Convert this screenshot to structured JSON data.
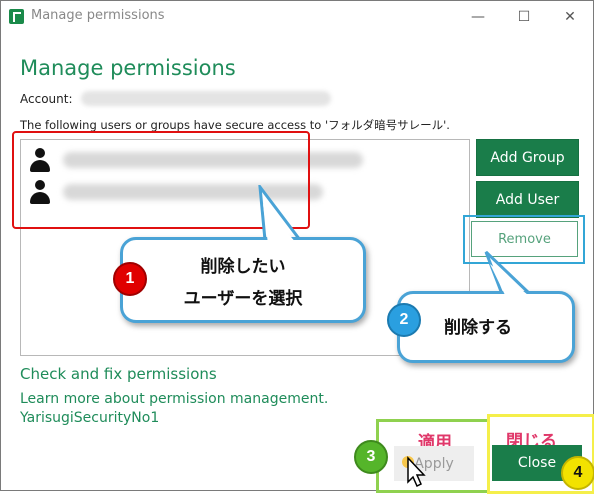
{
  "window": {
    "title": "Manage permissions",
    "controls": {
      "minimize": "—",
      "maximize": "☐",
      "close": "✕"
    }
  },
  "dialog": {
    "heading": "Manage permissions",
    "account_label": "Account:",
    "description": "The following users or groups have secure access to 'フォルダ暗号サレール'.",
    "users": [
      {
        "icon": "person-icon"
      },
      {
        "icon": "person-icon"
      }
    ],
    "buttons": {
      "add_group": "Add Group",
      "add_user": "Add User",
      "remove": "Remove",
      "apply": "Apply",
      "close": "Close"
    },
    "links": {
      "check_fix": "Check and fix permissions",
      "learn_more": "Learn more about permission management.",
      "account_name": "YarisugiSecurityNo1"
    }
  },
  "annotations": {
    "callout1": {
      "number": "1",
      "line1": "削除したい",
      "line2": "ユーザーを選択"
    },
    "callout2": {
      "number": "2",
      "text": "削除する"
    },
    "step3": {
      "number": "3",
      "label": "適用"
    },
    "step4": {
      "number": "4",
      "label": "閉じる"
    }
  },
  "colors": {
    "brand_green": "#1a7d4a",
    "heading_green": "#1f8c5a",
    "highlight_red": "#e01010",
    "highlight_blue": "#33a6d6",
    "highlight_lime": "#8fd14f",
    "highlight_yellow": "#f5ef4a",
    "annotation_pink": "#e0386a"
  }
}
